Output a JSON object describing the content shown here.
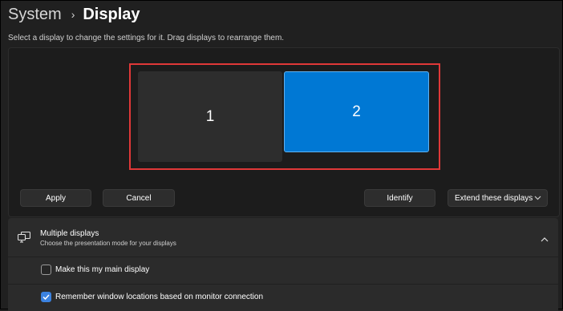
{
  "breadcrumb": {
    "parent": "System",
    "separator": "›",
    "current": "Display"
  },
  "instruction": "Select a display to change the settings for it. Drag displays to rearrange them.",
  "monitors": [
    {
      "number": "1",
      "selected": false
    },
    {
      "number": "2",
      "selected": true
    }
  ],
  "buttons": {
    "apply": "Apply",
    "cancel": "Cancel",
    "identify": "Identify",
    "extend": "Extend these displays"
  },
  "multiple_displays": {
    "title": "Multiple displays",
    "subtitle": "Choose the presentation mode for your displays",
    "expanded": true
  },
  "options": [
    {
      "label": "Make this my main display",
      "checked": false
    },
    {
      "label": "Remember window locations based on monitor connection",
      "checked": true
    }
  ],
  "colors": {
    "accent": "#0078d4",
    "selection_outline": "#e03838",
    "background": "#202020",
    "checkbox_checked": "#3b82e0"
  },
  "icons": [
    "chevron-right-icon",
    "chevron-down-icon",
    "chevron-up-icon",
    "monitor-icon",
    "checkmark-icon"
  ]
}
